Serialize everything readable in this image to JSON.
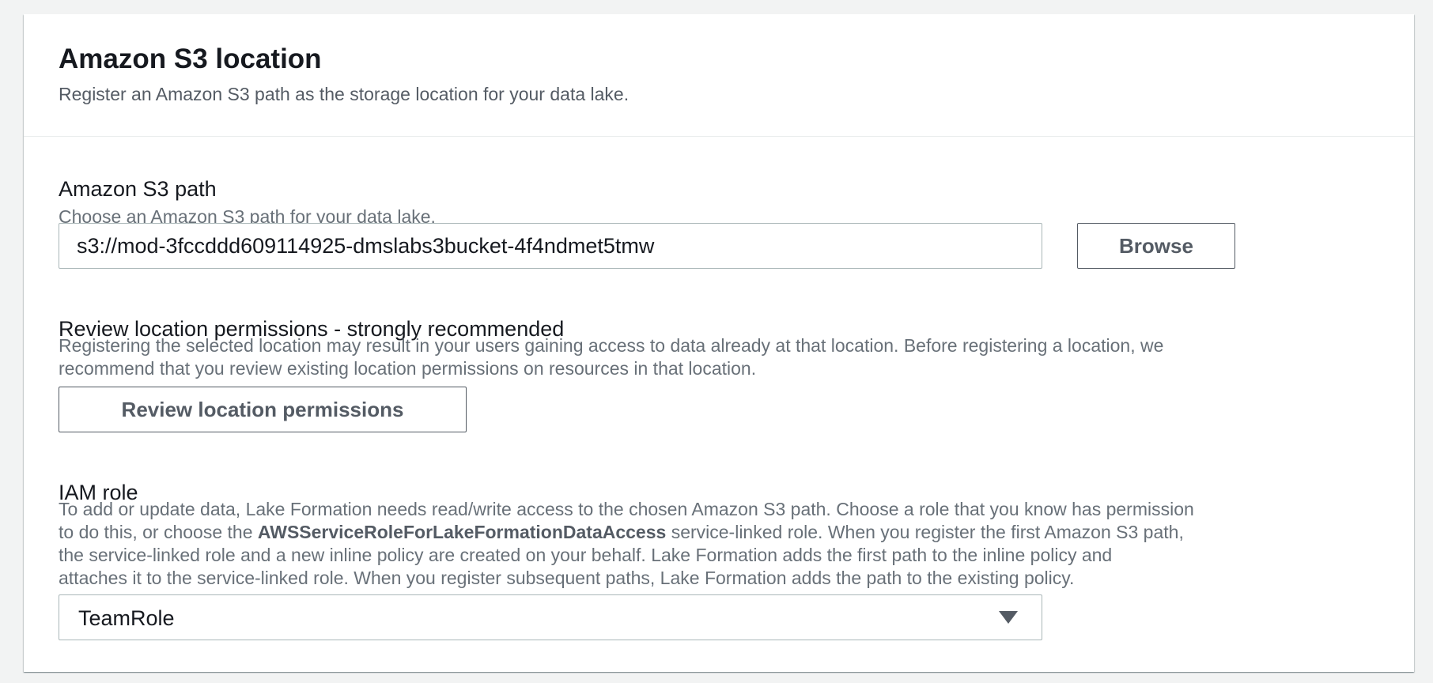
{
  "header": {
    "title": "Amazon S3 location",
    "description": "Register an Amazon S3 path as the storage location for your data lake."
  },
  "s3_path": {
    "label": "Amazon S3 path",
    "description": "Choose an Amazon S3 path for your data lake.",
    "value": "s3://mod-3fccddd609114925-dmslabs3bucket-4f4ndmet5tmw",
    "browse_label": "Browse"
  },
  "permissions": {
    "label": "Review location permissions - strongly recommended",
    "description_line1": "Registering the selected location may result in your users gaining access to data already at that location. Before registering a location, we",
    "description_line2": "recommend that you review existing location permissions on resources in that location.",
    "button_label": "Review location permissions"
  },
  "iam_role": {
    "label": "IAM role",
    "desc_line1": "To add or update data, Lake Formation needs read/write access to the chosen Amazon S3 path. Choose a role that you know has permission",
    "desc_line2_pre": "to do this, or choose the ",
    "desc_line2_bold": "AWSServiceRoleForLakeFormationDataAccess",
    "desc_line2_post": " service-linked role. When you register the first Amazon S3 path,",
    "desc_line3": "the service-linked role and a new inline policy are created on your behalf. Lake Formation adds the first path to the inline policy and",
    "desc_line4": "attaches it to the service-linked role. When you register subsequent paths, Lake Formation adds the path to the existing policy.",
    "selected": "TeamRole",
    "caret_icon": "caret-down-icon"
  }
}
